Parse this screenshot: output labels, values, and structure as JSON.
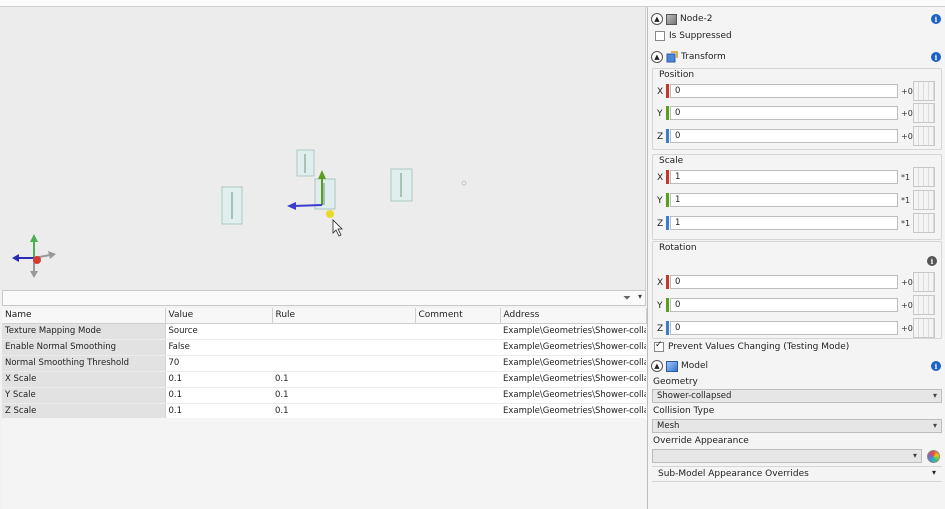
{
  "table": {
    "columns": [
      "Name",
      "Value",
      "Rule",
      "Comment",
      "Address"
    ],
    "rows": [
      {
        "name": "Texture Mapping Mode",
        "value": "Source",
        "rule": "",
        "comment": "",
        "address": "Example\\Geometries\\Shower-collapsed"
      },
      {
        "name": "Enable Normal Smoothing",
        "value": "False",
        "rule": "",
        "comment": "",
        "address": "Example\\Geometries\\Shower-collapsed"
      },
      {
        "name": "Normal Smoothing Threshold",
        "value": "70",
        "rule": "",
        "comment": "",
        "address": "Example\\Geometries\\Shower-collapsed"
      },
      {
        "name": "X Scale",
        "value": "0.1",
        "rule": "0.1",
        "comment": "",
        "address": "Example\\Geometries\\Shower-collapsed"
      },
      {
        "name": "Y Scale",
        "value": "0.1",
        "rule": "0.1",
        "comment": "",
        "address": "Example\\Geometries\\Shower-collapsed"
      },
      {
        "name": "Z Scale",
        "value": "0.1",
        "rule": "0.1",
        "comment": "",
        "address": "Example\\Geometries\\Shower-collapsed"
      }
    ]
  },
  "panel": {
    "node": {
      "title": "Node-2",
      "suppressed_label": "Is Suppressed",
      "suppressed": false
    },
    "transform": {
      "title": "Transform",
      "position": {
        "label": "Position",
        "x": "0",
        "y": "0",
        "z": "0",
        "dx": "+0",
        "dy": "+0",
        "dz": "+0"
      },
      "scale": {
        "label": "Scale",
        "x": "1",
        "y": "1",
        "z": "1",
        "dx": "*1",
        "dy": "*1",
        "dz": "*1"
      },
      "rotation": {
        "label": "Rotation",
        "x": "0",
        "y": "0",
        "z": "0",
        "dx": "+0",
        "dy": "+0",
        "dz": "+0"
      },
      "prevent_label": "Prevent Values Changing (Testing Mode)",
      "prevent": true
    },
    "model": {
      "title": "Model",
      "geometry_label": "Geometry",
      "geometry": "Shower-collapsed",
      "collision_label": "Collision Type",
      "collision": "Mesh",
      "override_label": "Override Appearance",
      "override": "",
      "submodel_label": "Sub-Model Appearance Overrides"
    }
  },
  "axis_labels": {
    "x": "X",
    "y": "Y",
    "z": "Z"
  },
  "colors": {
    "x_axis": "#c0392b",
    "y_axis": "#5a9e1e",
    "z_axis": "#3a7bd5",
    "info": "#1c62c4"
  }
}
